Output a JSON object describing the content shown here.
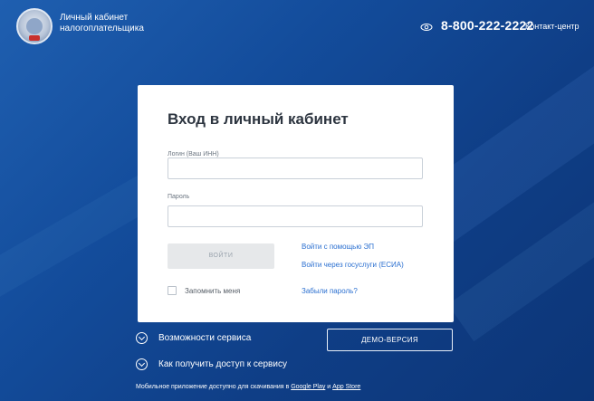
{
  "header": {
    "brand_line1": "Личный кабинет",
    "brand_line2": "налогоплательщика",
    "phone": "8-800-222-2222",
    "contact_label": "Контакт-центр",
    "icon_left": "emblem-icon",
    "icon_phone": "eye-icon"
  },
  "login_card": {
    "title": "Вход в личный кабинет",
    "login_label": "Логин (Ваш ИНН)",
    "login_value": "",
    "password_label": "Пароль",
    "password_value": "",
    "login_button": "ВОЙТИ",
    "link_ep": "Войти с помощью ЭП",
    "link_esia": "Войти через госуслуги (ЕСИА)",
    "remember_label": "Запомнить меня",
    "remember_checked": false,
    "forgot_link": "Забыли пароль?"
  },
  "below_card": {
    "features_label": "Возможности сервиса",
    "access_label": "Как получить доступ к сервису",
    "demo_button": "ДЕМО-ВЕРСИЯ"
  },
  "footer": {
    "text": "Мобильное приложение доступно для скачивания в",
    "google_play": "Google Play",
    "and": "и",
    "app_store": "App Store"
  },
  "colors": {
    "background": "#134c9b",
    "card": "#ffffff",
    "link": "#2a6fd0",
    "button_disabled": "#e6e8ea"
  }
}
